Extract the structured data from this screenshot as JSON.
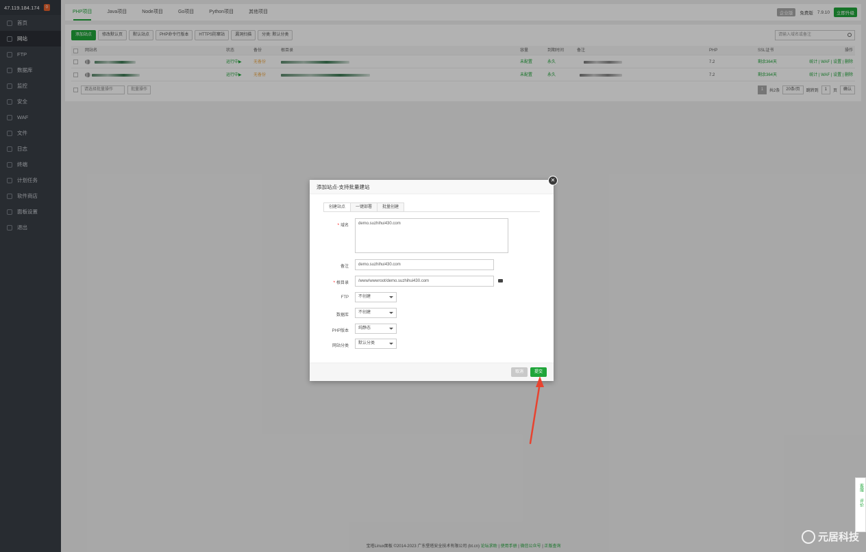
{
  "sidebar": {
    "ip": "47.119.184.174",
    "badge": "0",
    "items": [
      {
        "label": "首页",
        "icon": "home-icon"
      },
      {
        "label": "网站",
        "icon": "globe-icon"
      },
      {
        "label": "FTP",
        "icon": "user-icon"
      },
      {
        "label": "数据库",
        "icon": "database-icon"
      },
      {
        "label": "监控",
        "icon": "monitor-icon"
      },
      {
        "label": "安全",
        "icon": "shield-icon"
      },
      {
        "label": "WAF",
        "icon": "waf-icon"
      },
      {
        "label": "文件",
        "icon": "folder-icon"
      },
      {
        "label": "日志",
        "icon": "log-icon"
      },
      {
        "label": "终端",
        "icon": "terminal-icon"
      },
      {
        "label": "计划任务",
        "icon": "clock-icon"
      },
      {
        "label": "软件商店",
        "icon": "store-icon"
      },
      {
        "label": "面板设置",
        "icon": "settings-icon"
      },
      {
        "label": "退出",
        "icon": "logout-icon"
      }
    ]
  },
  "project_tabs": [
    "PHP项目",
    "Java项目",
    "Node项目",
    "Go项目",
    "Python项目",
    "其他项目"
  ],
  "topright": {
    "enterprise": "企业版",
    "free": "免费版",
    "version": "7.9.10",
    "upgrade": "立即升级"
  },
  "toolbar": {
    "buttons": [
      "添加站点",
      "修改默认页",
      "默认站点",
      "PHP命令行版本",
      "HTTPS防窜站",
      "漏洞扫描",
      "分类: 默认分类"
    ],
    "search_placeholder": "请输入域名或备注"
  },
  "table": {
    "headers": [
      "网站名",
      "状态",
      "备份",
      "根目录",
      "容量",
      "到期时间",
      "备注",
      "PHP",
      "SSL证书",
      "操作"
    ],
    "rows": [
      {
        "status": "运行中▶",
        "backup": "无备份",
        "quota": "未配置",
        "expire": "永久",
        "php": "7.2",
        "ssl": "剩余364天",
        "ops": "统计 | WAF | 设置 | 删除"
      },
      {
        "status": "运行中▶",
        "backup": "无备份",
        "quota": "未配置",
        "expire": "永久",
        "php": "7.2",
        "ssl": "剩余364天",
        "ops": "统计 | WAF | 设置 | 删除"
      }
    ],
    "batch_placeholder": "请选择批量操作",
    "batch_button": "批量操作",
    "pager": {
      "page": "1",
      "total": "共2条",
      "per_page": "20条/页",
      "jump_label": "跳转到",
      "jump_value": "1",
      "page_unit": "页",
      "confirm": "确认"
    }
  },
  "dialog": {
    "title": "添加站点-支持批量建站",
    "tabs": [
      "创建站点",
      "一键部署",
      "批量创建"
    ],
    "fields": {
      "domain_label": "域名",
      "domain_value": "demo.suzhihui430.com",
      "remark_label": "备注",
      "remark_value": "demo.suzhihui430.com",
      "root_label": "根目录",
      "root_value": "/www/wwwroot/demo.suzhihui430.com",
      "ftp_label": "FTP",
      "ftp_value": "不创建",
      "db_label": "数据库",
      "db_value": "不创建",
      "php_label": "PHP版本",
      "php_value": "纯静态",
      "cat_label": "网站分类",
      "cat_value": "默认分类"
    },
    "cancel": "取消",
    "submit": "提交",
    "close_glyph": "✕"
  },
  "right_tools": {
    "service": "客服",
    "review": "评价"
  },
  "footer": {
    "copyright": "宝塔Linux面板 ©2014-2023 广东堡塔安全技术有限公司 (bt.cn)",
    "links": [
      "论坛求助",
      "使用手册",
      "微信公众号",
      "正版查询"
    ]
  },
  "watermark": "元居科技",
  "colors": {
    "accent": "#20a53a",
    "sidebar": "#3a3f47",
    "arrow": "#e8432f"
  }
}
